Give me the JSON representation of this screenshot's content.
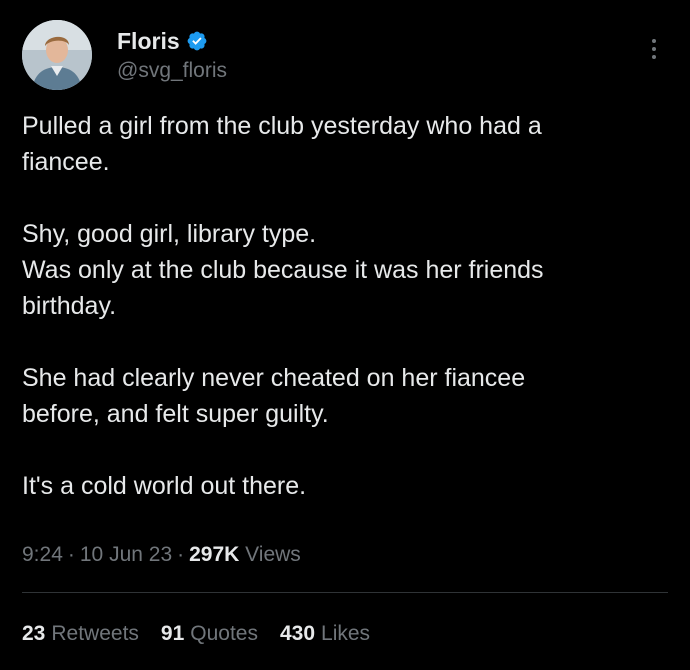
{
  "author": {
    "name": "Floris",
    "handle": "@svg_floris",
    "avatar_icon": "profile-photo",
    "verified_icon": "verified-badge-icon",
    "verified_color": "#1d9bf0"
  },
  "tweet": {
    "paragraphs": [
      [
        "Pulled a girl from the club yesterday who had a",
        "fiancee."
      ],
      [
        "Shy, good girl, library type.",
        "Was only at the club because it was her friends",
        "birthday."
      ],
      [
        "She had clearly never cheated on her fiancee",
        "before, and felt super guilty."
      ],
      [
        "It's a cold world out there."
      ]
    ]
  },
  "meta": {
    "time": "9:24",
    "separator": "·",
    "date": "10 Jun 23",
    "views_count": "297K",
    "views_label": "Views"
  },
  "stats": {
    "retweets_count": "23",
    "retweets_label": "Retweets",
    "quotes_count": "91",
    "quotes_label": "Quotes",
    "likes_count": "430",
    "likes_label": "Likes"
  },
  "colors": {
    "background": "#000000",
    "text": "#e7e9ea",
    "secondary": "#71767b",
    "divider": "#2f3336"
  }
}
